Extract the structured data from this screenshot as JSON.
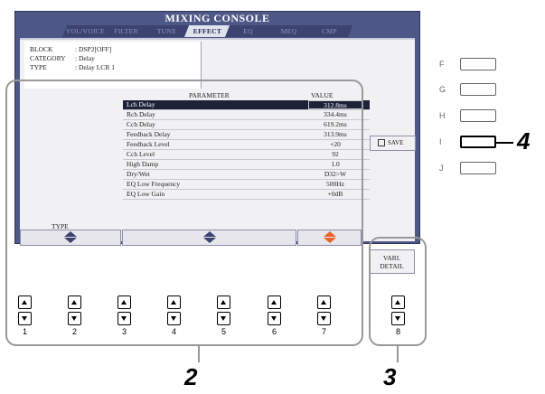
{
  "screen": {
    "title": "MIXING CONSOLE",
    "tabs": [
      "VOL/VOICE",
      "FILTER",
      "TUNE",
      "EFFECT",
      "EQ",
      "MEQ",
      "CMP"
    ],
    "active_tab": "EFFECT",
    "info": {
      "block_key": "BLOCK",
      "block_val": ": DSP2[OFF]",
      "category_key": "CATEGORY",
      "category_val": ": Delay",
      "type_key": "TYPE",
      "type_val": ": Delay LCR 1"
    },
    "param_header": "PARAMETER",
    "value_header": "VALUE",
    "params": [
      {
        "name": "Lch Delay",
        "value": "312.8ms"
      },
      {
        "name": "Rch Delay",
        "value": "334.4ms"
      },
      {
        "name": "Cch Delay",
        "value": "619.2ms"
      },
      {
        "name": "Feedback Delay",
        "value": "313.9ms"
      },
      {
        "name": "Feedback Level",
        "value": "+20"
      },
      {
        "name": "Cch Level",
        "value": "92"
      },
      {
        "name": "High Damp",
        "value": "1.0"
      },
      {
        "name": "Dry/Wet",
        "value": "D32>W"
      },
      {
        "name": "EQ Low Frequency",
        "value": "500Hz"
      },
      {
        "name": "EQ Low Gain",
        "value": "+0dB"
      }
    ],
    "type_label": "TYPE",
    "save_label": "SAVE",
    "vari_detail_line1": "VARI.",
    "vari_detail_line2": "DETAIL"
  },
  "side_buttons": [
    "F",
    "G",
    "H",
    "I",
    "J"
  ],
  "bottom_buttons": [
    "1",
    "2",
    "3",
    "4",
    "5",
    "6",
    "7",
    "8"
  ],
  "callouts": {
    "step_2": "2",
    "step_3": "3",
    "step_4": "4"
  }
}
